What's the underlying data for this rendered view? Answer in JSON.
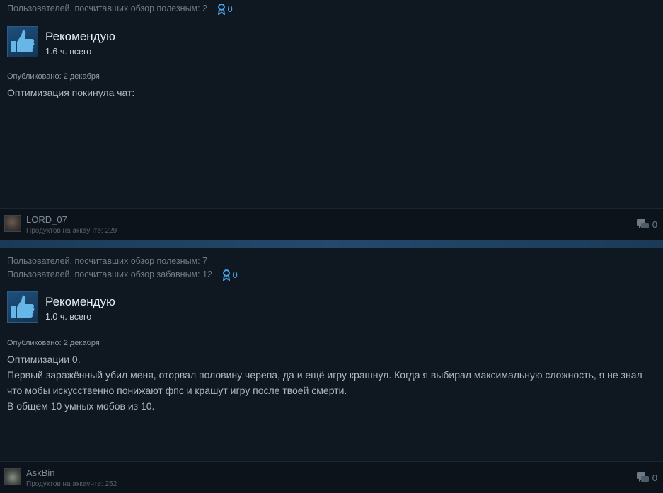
{
  "reviews": [
    {
      "votes": [
        "Пользователей, посчитавших обзор полезным: 2"
      ],
      "awards": "0",
      "recommendation": "Рекомендую",
      "hours": "1.6 ч. всего",
      "published": "Опубликовано: 2 декабря",
      "body": [
        "Оптимизация покинула чат:"
      ],
      "author": {
        "name": "LORD_07",
        "games": "Продуктов на аккаунте: 229"
      },
      "comments": "0"
    },
    {
      "votes": [
        "Пользователей, посчитавших обзор полезным: 7",
        "Пользователей, посчитавших обзор забавным: 12"
      ],
      "awards": "0",
      "recommendation": "Рекомендую",
      "hours": "1.0 ч. всего",
      "published": "Опубликовано: 2 декабря",
      "body": [
        "Оптимизации 0.",
        "Первый заражённый убил меня, оторвал половину черепа, да и ещё игру крашнул. Когда я выбирал максимальную сложность, я не знал что мобы искусственно понижают фпс и крашут игру после твоей смерти.",
        "В общем 10 умных мобов из 10."
      ],
      "author": {
        "name": "AskBin",
        "games": "Продуктов на аккаунте: 252"
      },
      "comments": "0"
    }
  ],
  "icons": {
    "thumb": "thumbs-up-icon",
    "award": "award-ribbon-icon",
    "comment": "comment-bubble-icon"
  },
  "colors": {
    "background": "#0f1720",
    "accent_blue": "#4aa0e0",
    "separator": "#1b3a57"
  }
}
